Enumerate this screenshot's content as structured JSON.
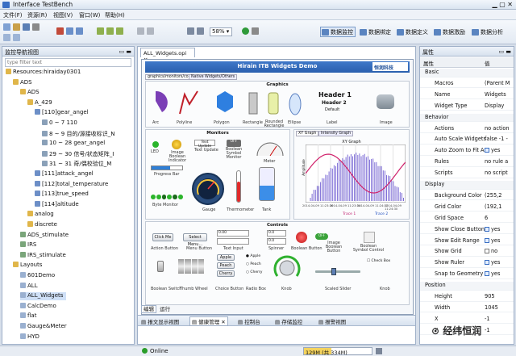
{
  "window": {
    "title": "Interface TestBench"
  },
  "menu": [
    "文件(F)",
    "资源(R)",
    "视图(V)",
    "窗口(W)",
    "帮助(H)"
  ],
  "toolbar": {
    "zoom": "58%"
  },
  "perspectives": [
    {
      "label": "数据监控",
      "active": true
    },
    {
      "label": "数据绑定",
      "active": false
    },
    {
      "label": "数据定义",
      "active": false
    },
    {
      "label": "数据激励",
      "active": false
    },
    {
      "label": "数据分析",
      "active": false
    }
  ],
  "left_panel": {
    "title": "监控导航视图",
    "filter_placeholder": "type filter text",
    "tree": [
      {
        "label": "Resources:hiraiday0301",
        "level": 0,
        "icon": "folder"
      },
      {
        "label": "ADS",
        "level": 1,
        "icon": "folder"
      },
      {
        "label": "ADS",
        "level": 2,
        "icon": "folder"
      },
      {
        "label": "A_429",
        "level": 3,
        "icon": "folder"
      },
      {
        "label": "[110]gear_angel",
        "level": 4,
        "icon": "node"
      },
      {
        "label": "0 ~ 7 110",
        "level": 5,
        "icon": "value"
      },
      {
        "label": "8 ~ 9 目的/源接收标识_N",
        "level": 5,
        "icon": "value"
      },
      {
        "label": "10 ~ 28 gear_angel",
        "level": 5,
        "icon": "value"
      },
      {
        "label": "29 ~ 30 信号/状态矩阵_I",
        "level": 5,
        "icon": "value"
      },
      {
        "label": "31 ~ 31 奇/偶校验位_M",
        "level": 5,
        "icon": "value"
      },
      {
        "label": "[111]attack_angel",
        "level": 4,
        "icon": "node"
      },
      {
        "label": "[112]total_temperature",
        "level": 4,
        "icon": "node"
      },
      {
        "label": "[113]true_speed",
        "level": 4,
        "icon": "node"
      },
      {
        "label": "[114]altitude",
        "level": 4,
        "icon": "node"
      },
      {
        "label": "analog",
        "level": 3,
        "icon": "folder"
      },
      {
        "label": "discrete",
        "level": 3,
        "icon": "folder"
      },
      {
        "label": "ADS_stimulate",
        "level": 2,
        "icon": "file"
      },
      {
        "label": "IRS",
        "level": 2,
        "icon": "file"
      },
      {
        "label": "IRS_stimulate",
        "level": 2,
        "icon": "file"
      },
      {
        "label": "Layouts",
        "level": 1,
        "icon": "folder"
      },
      {
        "label": "601Demo",
        "level": 2,
        "icon": "layout"
      },
      {
        "label": "ALL",
        "level": 2,
        "icon": "layout"
      },
      {
        "label": "ALL_Widgets",
        "level": 2,
        "icon": "layout",
        "selected": true
      },
      {
        "label": "CalcDemo",
        "level": 2,
        "icon": "layout"
      },
      {
        "label": "flat",
        "level": 2,
        "icon": "layout"
      },
      {
        "label": "Gauge&Meter",
        "level": 2,
        "icon": "layout"
      },
      {
        "label": "HYD",
        "level": 2,
        "icon": "layout"
      }
    ]
  },
  "editor": {
    "tab": "ALL_Widgets.opi",
    "banner": "Hirain ITB Widgets Demo",
    "logo": "恒润科技",
    "subtabs": [
      "graphics/monitors/control",
      "Native Widgets/Others"
    ],
    "graphics": {
      "title": "Graphics",
      "items": [
        "Arc",
        "Polyline",
        "Polygon",
        "Rectangle",
        "Rounded Rectangle",
        "Ellipse"
      ],
      "headers": [
        "Header 1",
        "Header 2",
        "Default"
      ],
      "label_caption": "Label",
      "image_caption": "Image"
    },
    "monitors": {
      "title": "Monitors",
      "items": [
        "LED",
        "Image Boolean Indicator",
        "Text Update",
        "Boolean Symbol Monitor",
        "Meter",
        "Progress Bar",
        "Byte Monitor",
        "Gauge",
        "Thermometer",
        "Tank"
      ],
      "text_update_value": "Text Update",
      "bool_text": "OFF"
    },
    "graph": {
      "tabs": [
        "XY Graph",
        "Intensity Graph"
      ],
      "title": "XY Graph",
      "trace1": "Trace 1",
      "trace2": "Trace 2",
      "xticks": [
        "2014-04-09 11:23:36",
        "2014-04-09 11:23:54",
        "2014-04-09 11:24:12",
        "2014-04-09 11:24:30"
      ],
      "ylabel": "Amplitude"
    },
    "controls": {
      "title": "Controls",
      "items": [
        "Action Button",
        "Menu Button",
        "Text Input",
        "Spinner",
        "Boolean Button",
        "Image Boolean Button",
        "Boolean Symbol Control",
        "Boolean Switch",
        "Thumb Wheel",
        "Choice Button",
        "Radio Box",
        "Knob",
        "Scaled Slider",
        "Check Box"
      ],
      "action_label": "Click Me",
      "menu_label": "Select Menu...",
      "text_input_value": "0.00",
      "spinner_values": [
        "0.0",
        "0.0"
      ],
      "toggle_label": "OFF",
      "choices": [
        "Apple",
        "Peach",
        "Cherry"
      ],
      "radios": [
        "Apple",
        "Peach",
        "Cherry"
      ],
      "check_label": "Check Box"
    },
    "mode_tabs": [
      "编辑",
      "运行"
    ]
  },
  "bottom_tabs": [
    "报文显示视图",
    "健康管理",
    "控制台",
    "存储监控",
    "报警视图"
  ],
  "right_panel": {
    "title": "属性",
    "col1": "属性",
    "col2": "值",
    "rows": [
      {
        "type": "cat",
        "k": "Basic"
      },
      {
        "k": "Macros",
        "v": "(Parent M"
      },
      {
        "k": "Name",
        "v": "Widgets"
      },
      {
        "k": "Widget Type",
        "v": "Display"
      },
      {
        "type": "cat",
        "k": "Behavior"
      },
      {
        "k": "Actions",
        "v": "no action"
      },
      {
        "k": "Auto Scale Widgets",
        "v": "false -1 -"
      },
      {
        "k": "Auto Zoom to Fit A",
        "v": "yes",
        "check": true
      },
      {
        "k": "Rules",
        "v": "no rule a"
      },
      {
        "k": "Scripts",
        "v": "no script"
      },
      {
        "type": "cat",
        "k": "Display"
      },
      {
        "k": "Background Color",
        "v": "(255,2"
      },
      {
        "k": "Grid Color",
        "v": "(192,1"
      },
      {
        "k": "Grid Space",
        "v": "6"
      },
      {
        "k": "Show Close Button",
        "v": "yes",
        "check": true
      },
      {
        "k": "Show Edit Range",
        "v": "yes",
        "check": true
      },
      {
        "k": "Show Grid",
        "v": "no",
        "check": false
      },
      {
        "k": "Show Ruler",
        "v": "yes",
        "check": true
      },
      {
        "k": "Snap to Geometry",
        "v": "yes",
        "check": true
      },
      {
        "type": "cat",
        "k": "Position"
      },
      {
        "k": "Height",
        "v": "905"
      },
      {
        "k": "Width",
        "v": "1045"
      },
      {
        "k": "X",
        "v": "-1"
      },
      {
        "k": "Y",
        "v": "-1"
      }
    ]
  },
  "status": {
    "online": "Online",
    "memory": "129M (共 334M)"
  },
  "watermark": "经纬恒润",
  "colors": {
    "accent": "#3a6fc4",
    "purple": "#7b3fb6",
    "selected": "#cfe0f7"
  }
}
